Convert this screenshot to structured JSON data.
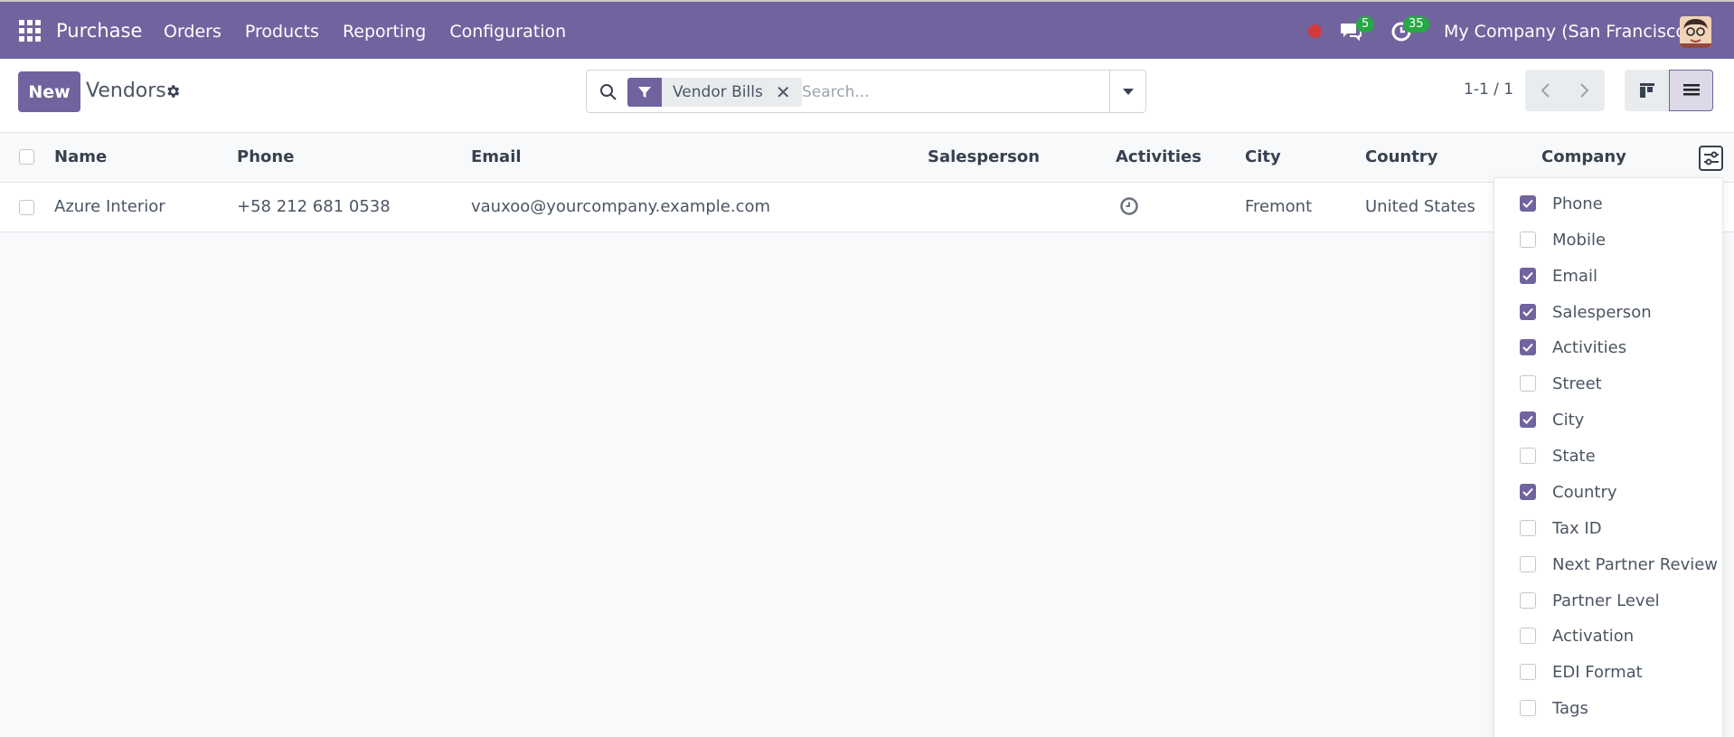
{
  "navbar": {
    "app_name": "Purchase",
    "menu": [
      "Orders",
      "Products",
      "Reporting",
      "Configuration"
    ],
    "messages_count": "5",
    "activities_count": "35",
    "company": "My Company (San Francisco)"
  },
  "control": {
    "new_label": "New",
    "title": "Vendors",
    "facet": "Vendor Bills",
    "search_placeholder": "Search...",
    "pager": "1-1 / 1"
  },
  "table": {
    "columns": [
      "Name",
      "Phone",
      "Email",
      "Salesperson",
      "Activities",
      "City",
      "Country",
      "Company"
    ],
    "rows": [
      {
        "name": "Azure Interior",
        "phone": "+58 212 681 0538",
        "email": "vauxoo@yourcompany.example.com",
        "salesperson": "",
        "city": "Fremont",
        "country": "United States"
      }
    ]
  },
  "optional_columns": [
    {
      "label": "Phone",
      "checked": true
    },
    {
      "label": "Mobile",
      "checked": false
    },
    {
      "label": "Email",
      "checked": true
    },
    {
      "label": "Salesperson",
      "checked": true
    },
    {
      "label": "Activities",
      "checked": true
    },
    {
      "label": "Street",
      "checked": false
    },
    {
      "label": "City",
      "checked": true
    },
    {
      "label": "State",
      "checked": false
    },
    {
      "label": "Country",
      "checked": true
    },
    {
      "label": "Tax ID",
      "checked": false
    },
    {
      "label": "Next Partner Review",
      "checked": false
    },
    {
      "label": "Partner Level",
      "checked": false
    },
    {
      "label": "Activation",
      "checked": false
    },
    {
      "label": "EDI Format",
      "checked": false
    },
    {
      "label": "Tags",
      "checked": false
    }
  ],
  "colors": {
    "brand": "#71639e",
    "badge": "#28a745",
    "record": "#d43a3a"
  }
}
